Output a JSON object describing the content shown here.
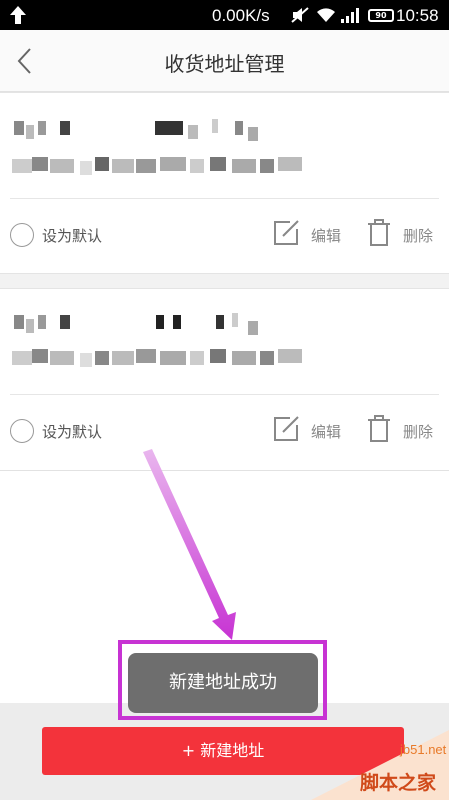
{
  "status_bar": {
    "network_speed": "0.00K/s",
    "battery": "90",
    "time": "10:58",
    "icons": [
      "upload-arrow-icon",
      "mute-icon",
      "wifi-icon",
      "signal-icon",
      "battery-icon"
    ]
  },
  "nav": {
    "title": "收货地址管理",
    "back_icon": "chevron-left-icon"
  },
  "addresses": [
    {
      "set_default_label": "设为默认",
      "edit_label": "编辑",
      "delete_label": "删除",
      "is_default": false
    },
    {
      "set_default_label": "设为默认",
      "edit_label": "编辑",
      "delete_label": "删除",
      "is_default": false
    }
  ],
  "toast": {
    "message": "新建地址成功"
  },
  "add_button": {
    "label": "+ 新建地址"
  },
  "watermark": {
    "url": "jb51.net",
    "name": "脚本之家"
  },
  "colors": {
    "accent": "#f3333b",
    "highlight": "#c733d3",
    "toast_bg": "#6e6e6e"
  }
}
